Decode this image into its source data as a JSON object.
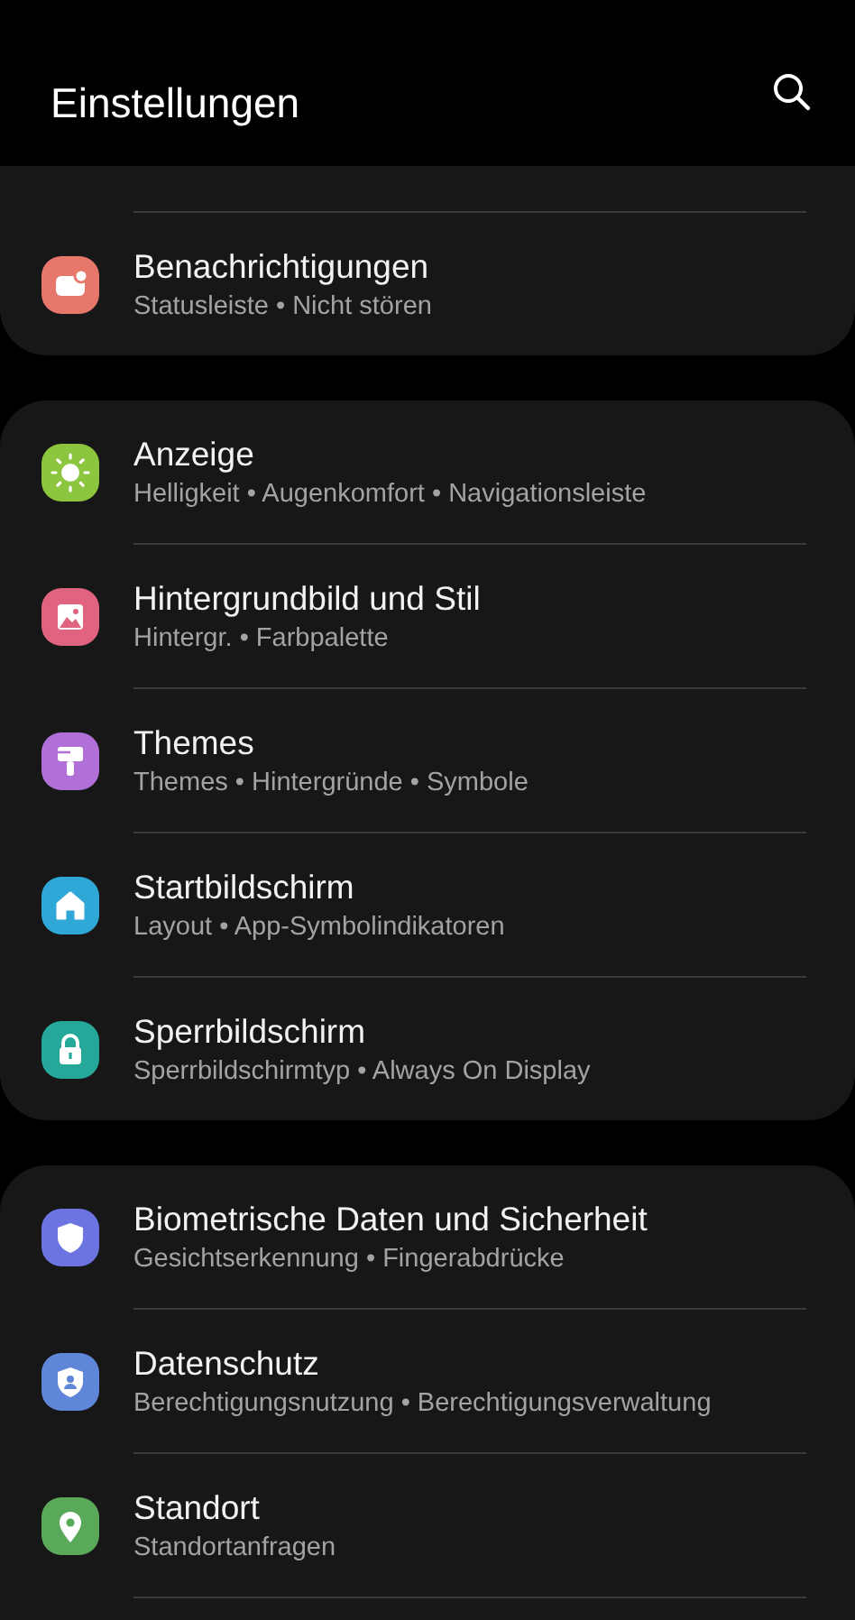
{
  "header": {
    "title": "Einstellungen"
  },
  "sections": [
    {
      "continued": true,
      "continues": false,
      "items": [
        {
          "kind": "notification",
          "color": "#e8776b",
          "title": "Benachrichtigungen",
          "subtitle": "Statusleiste • Nicht stören"
        }
      ]
    },
    {
      "continued": false,
      "continues": false,
      "items": [
        {
          "kind": "sun",
          "color": "#8cc63f",
          "title": "Anzeige",
          "subtitle": "Helligkeit • Augenkomfort • Navigationsleiste"
        },
        {
          "kind": "image",
          "color": "#e0647f",
          "title": "Hintergrundbild und Stil",
          "subtitle": "Hintergr. • Farbpalette"
        },
        {
          "kind": "brush",
          "color": "#b070d8",
          "title": "Themes",
          "subtitle": "Themes • Hintergründe • Symbole"
        },
        {
          "kind": "home",
          "color": "#2fa8d8",
          "title": "Startbildschirm",
          "subtitle": "Layout • App-Symbolindikatoren"
        },
        {
          "kind": "lock",
          "color": "#25a89a",
          "title": "Sperrbildschirm",
          "subtitle": "Sperrbildschirmtyp • Always On Display"
        }
      ]
    },
    {
      "continued": false,
      "continues": true,
      "items": [
        {
          "kind": "shield",
          "color": "#6b74e0",
          "title": "Biometrische Daten und Sicherheit",
          "subtitle": "Gesichtserkennung • Fingerabdrücke"
        },
        {
          "kind": "privacy",
          "color": "#5f86d8",
          "title": "Datenschutz",
          "subtitle": "Berechtigungsnutzung • Berechtigungsverwaltung"
        },
        {
          "kind": "location",
          "color": "#5aa85a",
          "title": "Standort",
          "subtitle": "Standortanfragen"
        }
      ]
    }
  ]
}
